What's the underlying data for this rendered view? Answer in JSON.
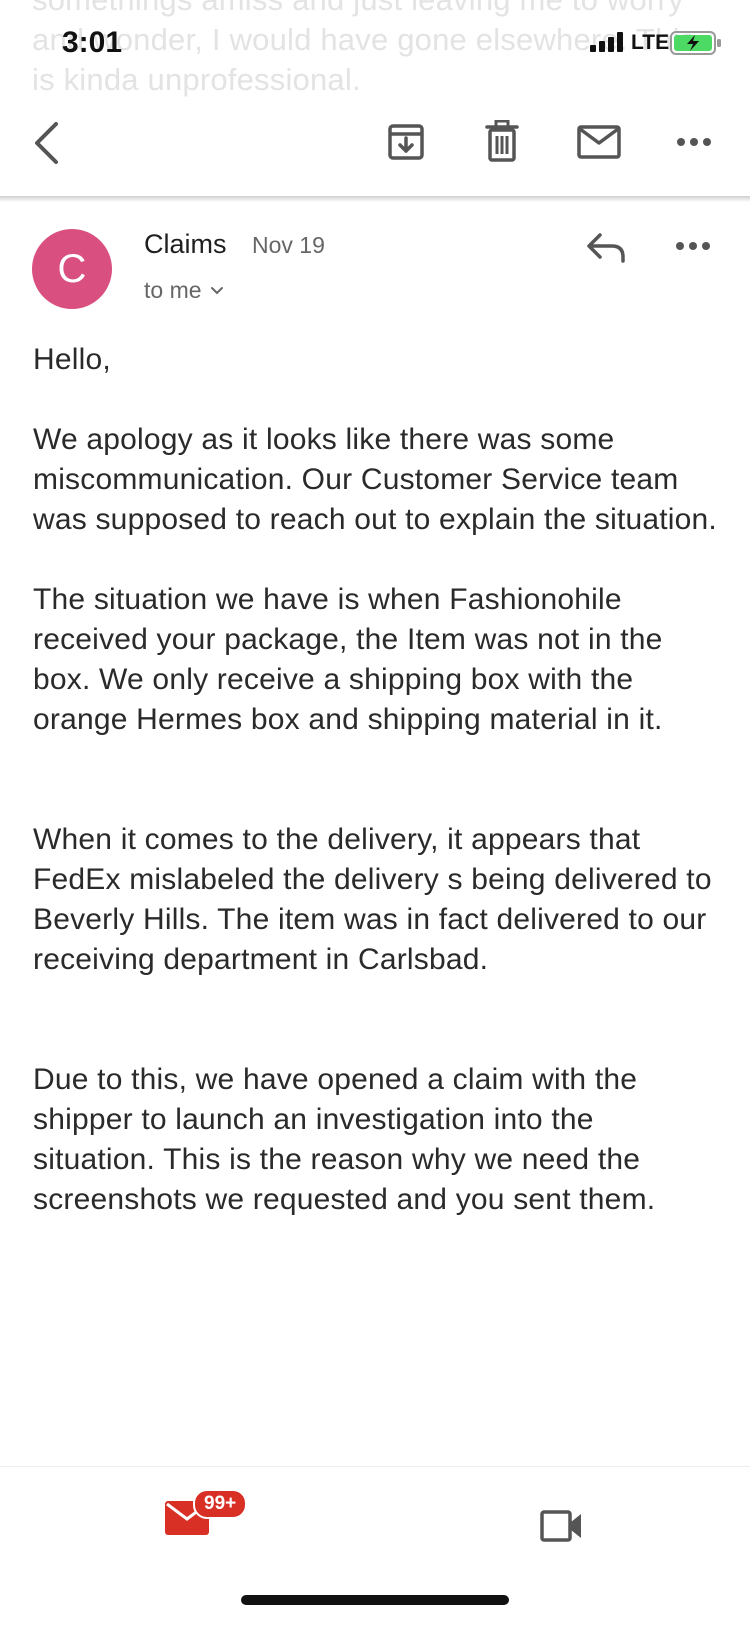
{
  "background_text": "somethings amiss and just leaving me to worry and wonder, I would have gone elsewhere. This is kinda unprofessional.",
  "status_bar": {
    "time": "3:01",
    "network": "LTE"
  },
  "toolbar": {
    "back_icon": "chevron-left-icon",
    "archive_icon": "archive-icon",
    "delete_icon": "trash-icon",
    "mark_unread_icon": "mail-icon",
    "more_icon": "more-horizontal-icon"
  },
  "message": {
    "avatar_letter": "C",
    "avatar_color": "#d94f7f",
    "sender": "Claims",
    "date": "Nov 19",
    "recipient": "to me",
    "body": {
      "greeting": "Hello,",
      "p1": "We apology as it looks like there was some miscommunication.  Our Customer Service team was supposed to reach out to explain the situation.",
      "p2": "The situation we have is when Fashionohile received your package, the Item was not in the box.  We only receive a shipping box with the orange Hermes box and shipping material in it.",
      "p3": "When it comes to the delivery, it appears that FedEx mislabeled the delivery s being delivered to Beverly Hills.  The item was in fact delivered to our receiving department in Carlsbad.",
      "p4": "Due to this, we have opened a claim with the shipper to launch an investigation into the situation. This is the reason why we need the screenshots we requested and you sent them."
    }
  },
  "bottom_nav": {
    "mail_badge": "99+",
    "mail_icon": "mail-icon",
    "meet_icon": "video-camera-icon",
    "accent_color": "#d93025"
  }
}
